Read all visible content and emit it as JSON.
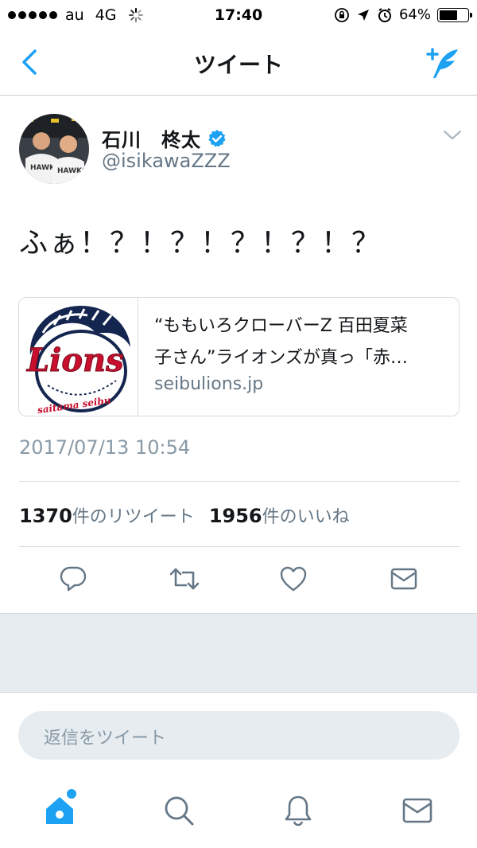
{
  "status_bar": {
    "carrier": "au",
    "network": "4G",
    "time": "17:40",
    "battery": "64%",
    "battery_level": 0.64
  },
  "nav": {
    "title": "ツイート",
    "back_icon": "chevron-left-icon",
    "compose_icon": "compose-tweet-icon"
  },
  "tweet": {
    "display_name": "石川　柊太",
    "handle": "@isikawaZZZ",
    "text": "ふぁ！？！？！？！？！？",
    "card": {
      "title_line1": "“ももいろクローバーZ 百田夏菜",
      "title_line2": "子さん”ライオンズが真っ「赤…",
      "domain": "seibulions.jp",
      "logo_text": "Lions",
      "logo_subtext": "saitama seibu"
    },
    "timestamp": "2017/07/13 10:54",
    "stats": {
      "retweet_count": "1370",
      "retweet_label": "件のリツイート",
      "like_count": "1956",
      "like_label": "件のいいね"
    }
  },
  "reply": {
    "placeholder": "返信をツイート"
  },
  "colors": {
    "accent": "#1da1f2",
    "text": "#14171a",
    "secondary": "#657786",
    "background_gray": "#e6ecf0",
    "lions_red": "#c8102e",
    "lions_navy": "#14264f"
  },
  "tabs": [
    "home-icon",
    "search-icon",
    "notifications-icon",
    "messages-icon"
  ]
}
